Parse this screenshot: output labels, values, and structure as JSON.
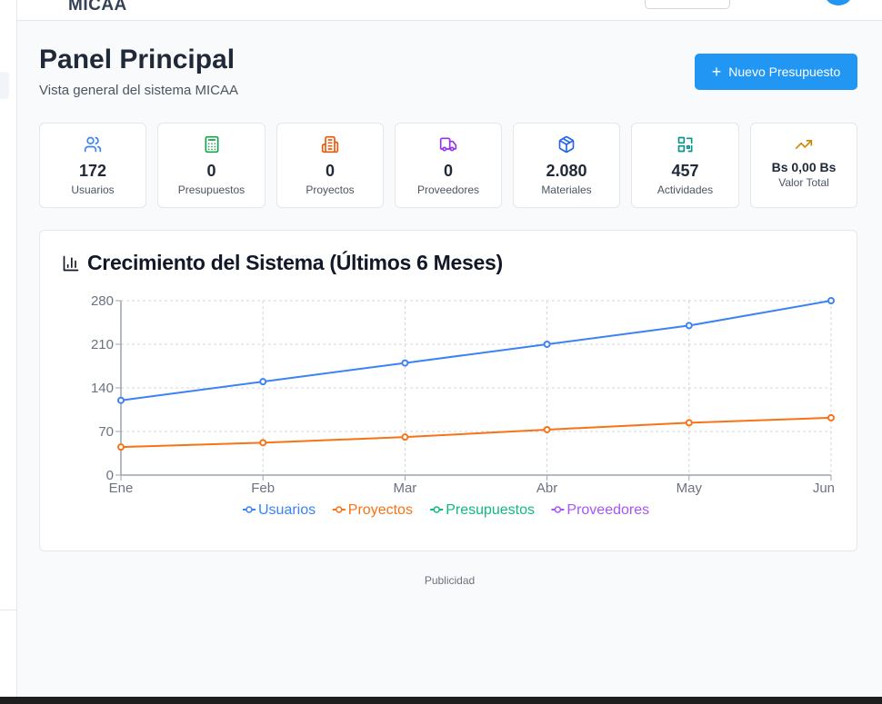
{
  "app": {
    "brand": "MICAA"
  },
  "header": {
    "title": "Panel Principal",
    "subtitle": "Vista general del sistema MICAA",
    "new_button_label": "Nuevo Presupuesto"
  },
  "stats": [
    {
      "icon": "users-icon",
      "value": "172",
      "label": "Usuarios",
      "color": "#3b82f6"
    },
    {
      "icon": "calculator-icon",
      "value": "0",
      "label": "Presupuestos",
      "color": "#16a34a"
    },
    {
      "icon": "building-icon",
      "value": "0",
      "label": "Proyectos",
      "color": "#ea580c"
    },
    {
      "icon": "truck-icon",
      "value": "0",
      "label": "Proveedores",
      "color": "#9333ea"
    },
    {
      "icon": "package-icon",
      "value": "2.080",
      "label": "Materiales",
      "color": "#2563eb"
    },
    {
      "icon": "activity-icon",
      "value": "457",
      "label": "Actividades",
      "color": "#0d9488"
    },
    {
      "icon": "trending-up-icon",
      "value": "Bs 0,00 Bs",
      "label": "Valor Total",
      "color": "#ca8a04"
    }
  ],
  "chart": {
    "title": "Crecimiento del Sistema (Últimos 6 Meses)"
  },
  "chart_data": {
    "type": "line",
    "title": "Crecimiento del Sistema (Últimos 6 Meses)",
    "categories": [
      "Ene",
      "Feb",
      "Mar",
      "Abr",
      "May",
      "Jun"
    ],
    "ylim": [
      0,
      280
    ],
    "yticks": [
      0,
      70,
      140,
      210,
      280
    ],
    "grid": true,
    "legend_position": "bottom",
    "series": [
      {
        "name": "Usuarios",
        "color": "#3b82f6",
        "values": [
          120,
          150,
          180,
          210,
          240,
          280
        ],
        "markers": true
      },
      {
        "name": "Proyectos",
        "color": "#f97316",
        "values": [
          45,
          52,
          61,
          73,
          84,
          92
        ],
        "markers": true
      },
      {
        "name": "Presupuestos",
        "color": "#10b981",
        "values": [],
        "markers": false
      },
      {
        "name": "Proveedores",
        "color": "#a855f7",
        "values": [],
        "markers": false
      }
    ]
  },
  "footer": {
    "ad_label": "Publicidad"
  }
}
